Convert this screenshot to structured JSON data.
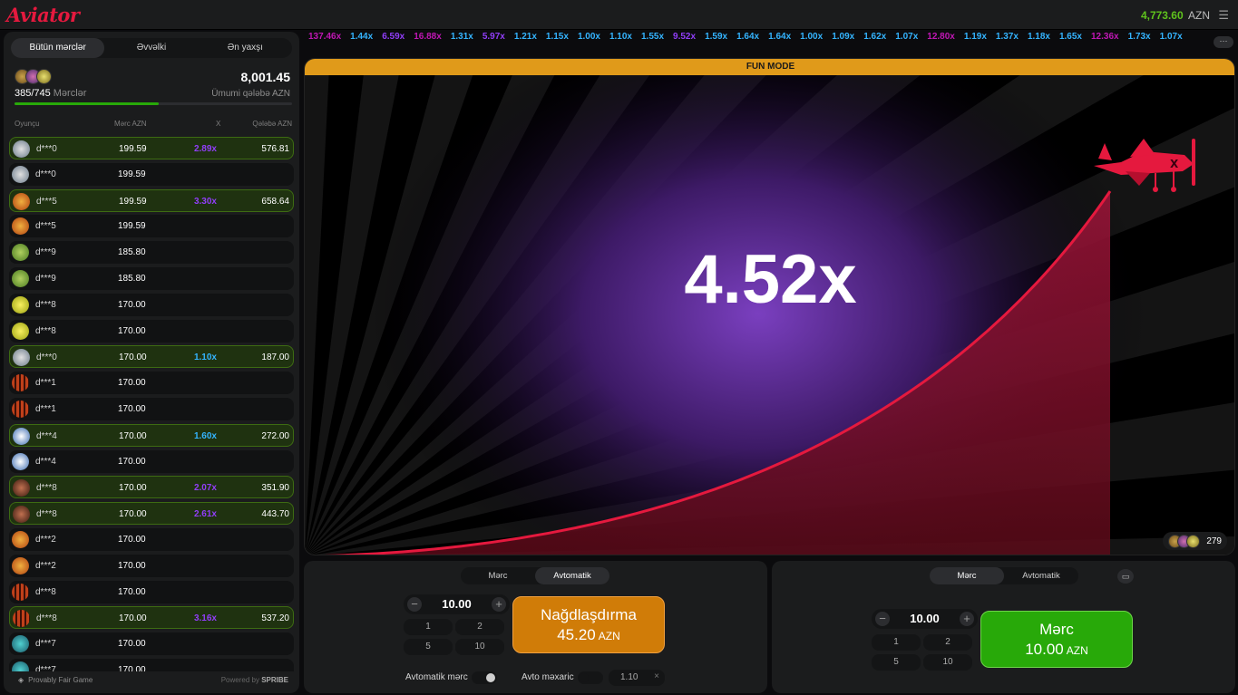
{
  "app": {
    "logo": "Aviator",
    "balance": "4,773.60",
    "currency": "AZN"
  },
  "left_panel": {
    "tabs": [
      "Bütün mərclər",
      "Əvvəlki",
      "Ən yaxşı"
    ],
    "bets_count": "385/745",
    "bets_label": "Mərclər",
    "total_win": "8,001.45",
    "total_win_label": "Ümumi qələbə AZN",
    "progress": 0.52,
    "columns": {
      "player": "Oyunçu",
      "bet": "Mərc AZN",
      "mult": "X",
      "win": "Qələbə AZN"
    },
    "rows": [
      {
        "name": "d***0",
        "bet": "199.59",
        "mult": "2.89x",
        "win": "576.81",
        "mc": "#913ef8",
        "av": "silver"
      },
      {
        "name": "d***0",
        "bet": "199.59",
        "mult": "",
        "win": "",
        "av": "silver"
      },
      {
        "name": "d***5",
        "bet": "199.59",
        "mult": "3.30x",
        "win": "658.64",
        "mc": "#913ef8",
        "av": "orange"
      },
      {
        "name": "d***5",
        "bet": "199.59",
        "mult": "",
        "win": "",
        "av": "orange"
      },
      {
        "name": "d***9",
        "bet": "185.80",
        "mult": "",
        "win": "",
        "av": "green"
      },
      {
        "name": "d***9",
        "bet": "185.80",
        "mult": "",
        "win": "",
        "av": "green"
      },
      {
        "name": "d***8",
        "bet": "170.00",
        "mult": "",
        "win": "",
        "av": "yellow"
      },
      {
        "name": "d***8",
        "bet": "170.00",
        "mult": "",
        "win": "",
        "av": "yellow"
      },
      {
        "name": "d***0",
        "bet": "170.00",
        "mult": "1.10x",
        "win": "187.00",
        "mc": "#34b4ff",
        "av": "silver"
      },
      {
        "name": "d***1",
        "bet": "170.00",
        "mult": "",
        "win": "",
        "av": "stripe"
      },
      {
        "name": "d***1",
        "bet": "170.00",
        "mult": "",
        "win": "",
        "av": "stripe"
      },
      {
        "name": "d***4",
        "bet": "170.00",
        "mult": "1.60x",
        "win": "272.00",
        "mc": "#34b4ff",
        "av": "white"
      },
      {
        "name": "d***4",
        "bet": "170.00",
        "mult": "",
        "win": "",
        "av": "white"
      },
      {
        "name": "d***8",
        "bet": "170.00",
        "mult": "2.07x",
        "win": "351.90",
        "mc": "#913ef8",
        "av": "face"
      },
      {
        "name": "d***8",
        "bet": "170.00",
        "mult": "2.61x",
        "win": "443.70",
        "mc": "#913ef8",
        "av": "face"
      },
      {
        "name": "d***2",
        "bet": "170.00",
        "mult": "",
        "win": "",
        "av": "orange"
      },
      {
        "name": "d***2",
        "bet": "170.00",
        "mult": "",
        "win": "",
        "av": "orange"
      },
      {
        "name": "d***8",
        "bet": "170.00",
        "mult": "",
        "win": "",
        "av": "stripe"
      },
      {
        "name": "d***8",
        "bet": "170.00",
        "mult": "3.16x",
        "win": "537.20",
        "mc": "#913ef8",
        "av": "stripe"
      },
      {
        "name": "d***7",
        "bet": "170.00",
        "mult": "",
        "win": "",
        "av": "teal"
      },
      {
        "name": "d***7",
        "bet": "170.00",
        "mult": "",
        "win": "",
        "av": "teal"
      }
    ],
    "footer_left": "Provably Fair Game",
    "footer_right_a": "Powered by",
    "footer_right_b": "SPRIBE"
  },
  "history": [
    {
      "v": "137.46x",
      "c": "#c017b4"
    },
    {
      "v": "1.44x",
      "c": "#34b4ff"
    },
    {
      "v": "6.59x",
      "c": "#913ef8"
    },
    {
      "v": "16.88x",
      "c": "#c017b4"
    },
    {
      "v": "1.31x",
      "c": "#34b4ff"
    },
    {
      "v": "5.97x",
      "c": "#913ef8"
    },
    {
      "v": "1.21x",
      "c": "#34b4ff"
    },
    {
      "v": "1.15x",
      "c": "#34b4ff"
    },
    {
      "v": "1.00x",
      "c": "#34b4ff"
    },
    {
      "v": "1.10x",
      "c": "#34b4ff"
    },
    {
      "v": "1.55x",
      "c": "#34b4ff"
    },
    {
      "v": "9.52x",
      "c": "#913ef8"
    },
    {
      "v": "1.59x",
      "c": "#34b4ff"
    },
    {
      "v": "1.64x",
      "c": "#34b4ff"
    },
    {
      "v": "1.64x",
      "c": "#34b4ff"
    },
    {
      "v": "1.00x",
      "c": "#34b4ff"
    },
    {
      "v": "1.09x",
      "c": "#34b4ff"
    },
    {
      "v": "1.62x",
      "c": "#34b4ff"
    },
    {
      "v": "1.07x",
      "c": "#34b4ff"
    },
    {
      "v": "12.80x",
      "c": "#c017b4"
    },
    {
      "v": "1.19x",
      "c": "#34b4ff"
    },
    {
      "v": "1.37x",
      "c": "#34b4ff"
    },
    {
      "v": "1.18x",
      "c": "#34b4ff"
    },
    {
      "v": "1.65x",
      "c": "#34b4ff"
    },
    {
      "v": "12.36x",
      "c": "#c017b4"
    },
    {
      "v": "1.73x",
      "c": "#34b4ff"
    },
    {
      "v": "1.07x",
      "c": "#34b4ff"
    }
  ],
  "game": {
    "mode": "FUN MODE",
    "multiplier": "4.52x",
    "players": "279"
  },
  "panel1": {
    "tab_bet": "Mərc",
    "tab_auto": "Avtomatik",
    "amount": "10.00",
    "quick": [
      "1",
      "2",
      "5",
      "10"
    ],
    "btn_line1": "Nağdlaşdırma",
    "btn_amount": "45.20",
    "btn_currency": "AZN",
    "auto_bet_label": "Avtomatik mərc",
    "auto_cashout_label": "Avto məxaric",
    "auto_cashout_value": "1.10",
    "clear": "×"
  },
  "panel2": {
    "tab_bet": "Mərc",
    "tab_auto": "Avtomatik",
    "amount": "10.00",
    "quick": [
      "1",
      "2",
      "5",
      "10"
    ],
    "btn_line1": "Mərc",
    "btn_amount": "10.00",
    "btn_currency": "AZN"
  }
}
